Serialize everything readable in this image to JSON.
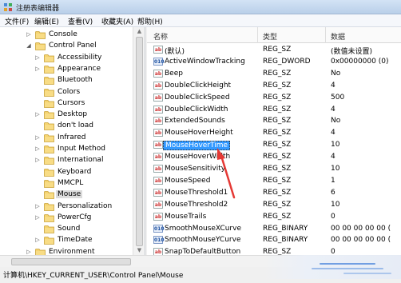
{
  "window": {
    "title": "注册表编辑器"
  },
  "menubar": {
    "items": [
      "文件(F)",
      "编辑(E)",
      "查看(V)",
      "收藏夹(A)",
      "帮助(H)"
    ]
  },
  "tree": {
    "items": [
      {
        "label": "Console",
        "expander": "collapsed"
      },
      {
        "label": "Control Panel",
        "expander": "expanded"
      },
      {
        "label": "Accessibility",
        "expander": "collapsed"
      },
      {
        "label": "Appearance",
        "expander": "collapsed"
      },
      {
        "label": "Bluetooth",
        "expander": "none"
      },
      {
        "label": "Colors",
        "expander": "none"
      },
      {
        "label": "Cursors",
        "expander": "none"
      },
      {
        "label": "Desktop",
        "expander": "collapsed"
      },
      {
        "label": "don't load",
        "expander": "none"
      },
      {
        "label": "Infrared",
        "expander": "collapsed"
      },
      {
        "label": "Input Method",
        "expander": "collapsed"
      },
      {
        "label": "International",
        "expander": "collapsed"
      },
      {
        "label": "Keyboard",
        "expander": "none"
      },
      {
        "label": "MMCPL",
        "expander": "none"
      },
      {
        "label": "Mouse",
        "expander": "none",
        "selected": true
      },
      {
        "label": "Personalization",
        "expander": "collapsed"
      },
      {
        "label": "PowerCfg",
        "expander": "collapsed"
      },
      {
        "label": "Sound",
        "expander": "none"
      },
      {
        "label": "TimeDate",
        "expander": "collapsed"
      },
      {
        "label": "Environment",
        "expander": "collapsed"
      }
    ]
  },
  "list": {
    "headers": {
      "name": "名称",
      "type": "类型",
      "data": "数据"
    },
    "rows": [
      {
        "name": "(默认)",
        "type": "REG_SZ",
        "data": "(数值未设置)",
        "icon": "string-value-icon"
      },
      {
        "name": "ActiveWindowTracking",
        "type": "REG_DWORD",
        "data": "0x00000000 (0)",
        "icon": "binary-value-icon"
      },
      {
        "name": "Beep",
        "type": "REG_SZ",
        "data": "No",
        "icon": "string-value-icon"
      },
      {
        "name": "DoubleClickHeight",
        "type": "REG_SZ",
        "data": "4",
        "icon": "string-value-icon"
      },
      {
        "name": "DoubleClickSpeed",
        "type": "REG_SZ",
        "data": "500",
        "icon": "string-value-icon"
      },
      {
        "name": "DoubleClickWidth",
        "type": "REG_SZ",
        "data": "4",
        "icon": "string-value-icon"
      },
      {
        "name": "ExtendedSounds",
        "type": "REG_SZ",
        "data": "No",
        "icon": "string-value-icon"
      },
      {
        "name": "MouseHoverHeight",
        "type": "REG_SZ",
        "data": "4",
        "icon": "string-value-icon"
      },
      {
        "name": "MouseHoverTime",
        "type": "REG_SZ",
        "data": "10",
        "icon": "string-value-icon",
        "selected": true
      },
      {
        "name": "MouseHoverWidth",
        "type": "REG_SZ",
        "data": "4",
        "icon": "string-value-icon"
      },
      {
        "name": "MouseSensitivity",
        "type": "REG_SZ",
        "data": "10",
        "icon": "string-value-icon"
      },
      {
        "name": "MouseSpeed",
        "type": "REG_SZ",
        "data": "1",
        "icon": "string-value-icon"
      },
      {
        "name": "MouseThreshold1",
        "type": "REG_SZ",
        "data": "6",
        "icon": "string-value-icon"
      },
      {
        "name": "MouseThreshold2",
        "type": "REG_SZ",
        "data": "10",
        "icon": "string-value-icon"
      },
      {
        "name": "MouseTrails",
        "type": "REG_SZ",
        "data": "0",
        "icon": "string-value-icon"
      },
      {
        "name": "SmoothMouseXCurve",
        "type": "REG_BINARY",
        "data": "00 00 00 00 00 (",
        "icon": "binary-value-icon"
      },
      {
        "name": "SmoothMouseYCurve",
        "type": "REG_BINARY",
        "data": "00 00 00 00 00 (",
        "icon": "binary-value-icon"
      },
      {
        "name": "SnapToDefaultButton",
        "type": "REG_SZ",
        "data": "0",
        "icon": "string-value-icon"
      }
    ]
  },
  "statusbar": {
    "path": "计算机\\HKEY_CURRENT_USER\\Control Panel\\Mouse"
  },
  "colors": {
    "selection": "#3399ff",
    "annotation_arrow": "#e53935"
  }
}
